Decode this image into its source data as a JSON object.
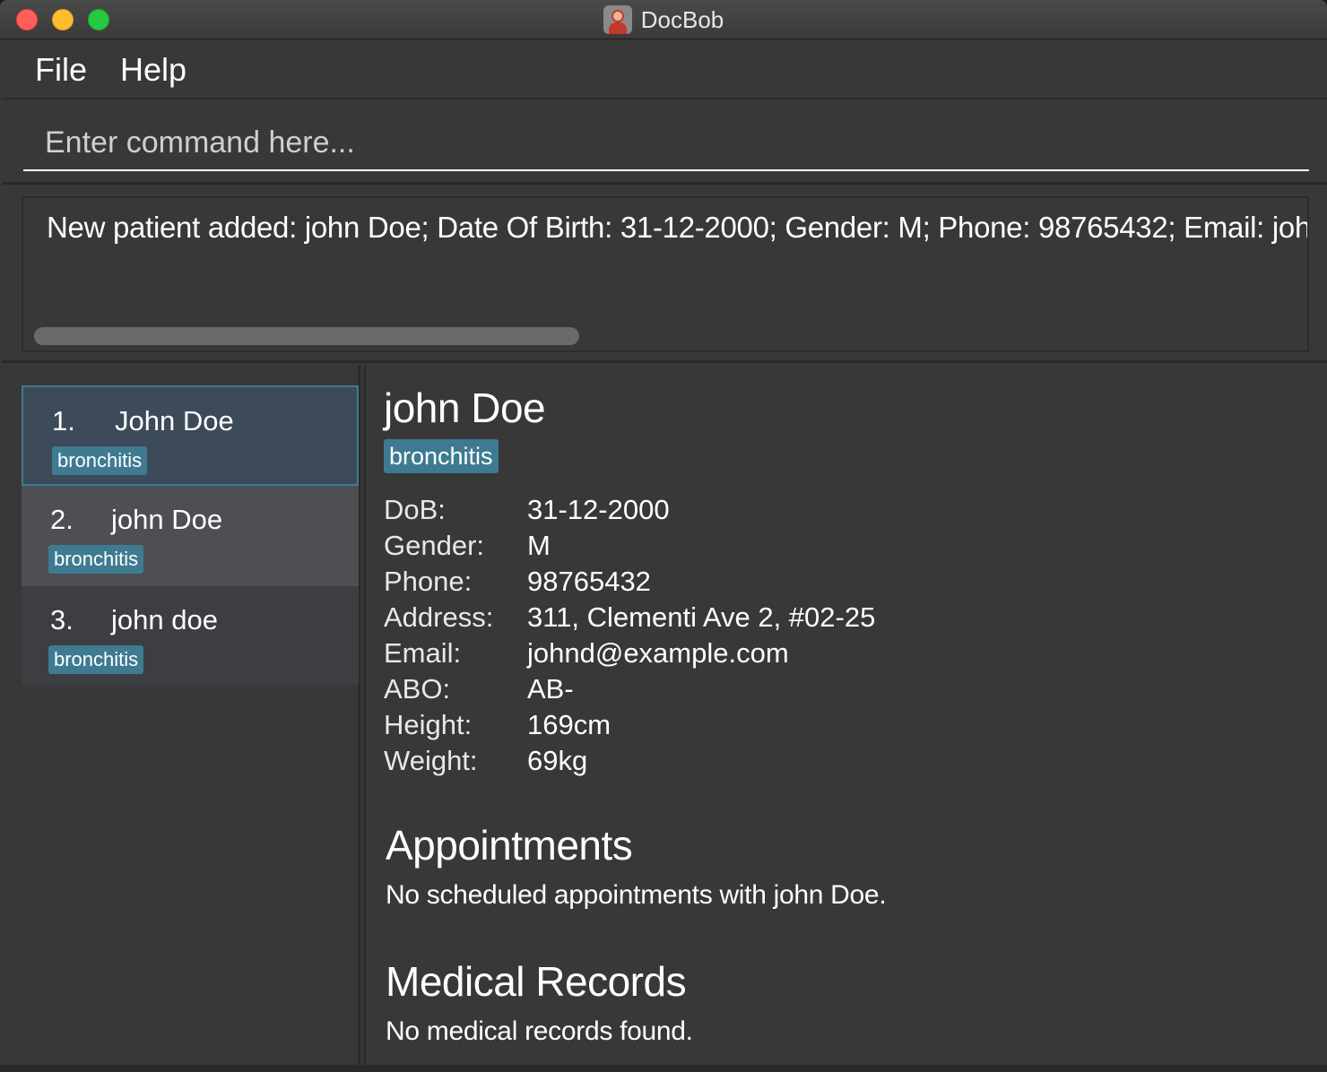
{
  "window": {
    "title": "DocBob"
  },
  "menu": {
    "file": "File",
    "help": "Help"
  },
  "command": {
    "placeholder": "Enter command here...",
    "value": ""
  },
  "result": {
    "text": "New patient added: john Doe; Date Of Birth: 31-12-2000; Gender: M; Phone: 98765432; Email: johnd@example.com"
  },
  "patients": [
    {
      "index": "1.",
      "name": "John Doe",
      "tag": "bronchitis"
    },
    {
      "index": "2.",
      "name": "john Doe",
      "tag": "bronchitis"
    },
    {
      "index": "3.",
      "name": "john doe",
      "tag": "bronchitis"
    }
  ],
  "detail": {
    "name": "john Doe",
    "tag": "bronchitis",
    "fields": [
      {
        "label": "DoB:",
        "value": "31-12-2000"
      },
      {
        "label": "Gender:",
        "value": "M"
      },
      {
        "label": "Phone:",
        "value": "98765432"
      },
      {
        "label": "Address:",
        "value": "311, Clementi Ave 2, #02-25"
      },
      {
        "label": "Email:",
        "value": "johnd@example.com"
      },
      {
        "label": "ABO:",
        "value": "AB-"
      },
      {
        "label": "Height:",
        "value": "169cm"
      },
      {
        "label": "Weight:",
        "value": "69kg"
      }
    ],
    "appointments": {
      "title": "Appointments",
      "text": "No scheduled appointments with john Doe."
    },
    "records": {
      "title": "Medical Records",
      "text": "No medical records found."
    }
  },
  "colors": {
    "background": "#383838",
    "tag": "#3e7b91",
    "selected_card": "#3c4a5a"
  }
}
